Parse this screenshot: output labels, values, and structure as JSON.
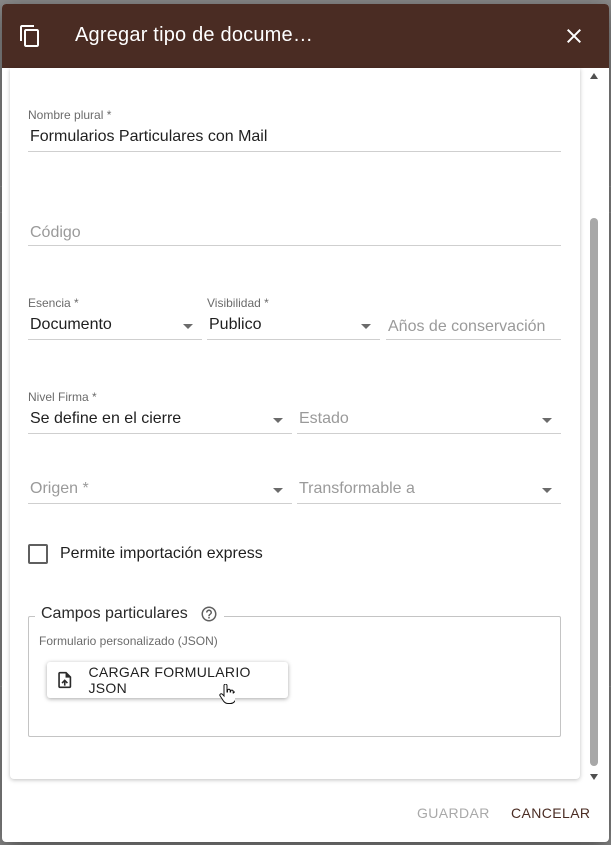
{
  "header": {
    "title": "Agregar tipo de docume…",
    "icon": "copy-icon",
    "close_icon": "close-icon",
    "color": "#4a2c23"
  },
  "form": {
    "nombre_plural": {
      "label": "Nombre plural",
      "required": "*",
      "value": "Formularios Particulares con Mail"
    },
    "codigo": {
      "placeholder": "Código"
    },
    "esencia": {
      "label": "Esencia",
      "required": "*",
      "value": "Documento"
    },
    "visibilidad": {
      "label": "Visibilidad",
      "required": "*",
      "value": "Publico"
    },
    "anios": {
      "placeholder": "Años de conservación"
    },
    "nivel_firma": {
      "label": "Nivel Firma",
      "required": "*",
      "value": "Se define en el cierre"
    },
    "estado": {
      "placeholder": "Estado"
    },
    "origen": {
      "placeholder": "Origen *"
    },
    "transformable": {
      "placeholder": "Transformable a"
    },
    "permite_importacion": {
      "label": "Permite importación express",
      "checked": false
    }
  },
  "campos": {
    "legend": "Campos particulares",
    "help_icon": "help-circle-icon",
    "sub_label": "Formulario personalizado (JSON)",
    "upload_label": "CARGAR FORMULARIO JSON",
    "upload_icon": "file-upload-icon"
  },
  "actions": {
    "save_label": "GUARDAR",
    "cancel_label": "CANCELAR"
  }
}
